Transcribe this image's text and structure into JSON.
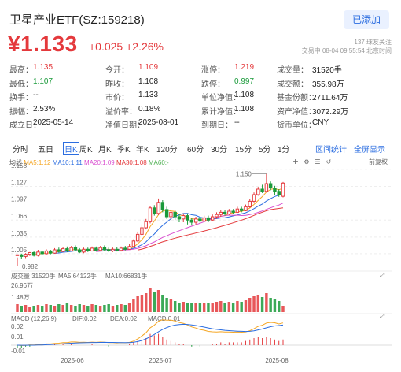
{
  "header": {
    "title": "卫星产业ETF(SZ:159218)",
    "add_label": "已添加",
    "price": "¥1.133",
    "change": "+0.025",
    "change_pct": "+2.26%",
    "follow_count": "137 球友关注",
    "trade_time": "交易中 08-04 09:55:54 北京时间"
  },
  "quote": [
    [
      {
        "k": "最高：",
        "v": "1.135",
        "c": "red"
      },
      {
        "k": "今开：",
        "v": "1.109",
        "c": "red"
      },
      {
        "k": "涨停：",
        "v": "1.219",
        "c": "red"
      },
      {
        "k": "成交量：",
        "v": "31520手",
        "c": ""
      }
    ],
    [
      {
        "k": "最低：",
        "v": "1.107",
        "c": "green"
      },
      {
        "k": "昨收：",
        "v": "1.108",
        "c": ""
      },
      {
        "k": "跌停：",
        "v": "0.997",
        "c": "green"
      },
      {
        "k": "成交额：",
        "v": "355.98万",
        "c": ""
      }
    ],
    [
      {
        "k": "换手：",
        "v": "--",
        "c": ""
      },
      {
        "k": "市价：",
        "v": "1.133",
        "c": ""
      },
      {
        "k": "单位净值：",
        "v": "1.108",
        "c": ""
      },
      {
        "k": "基金份额：",
        "v": "2711.64万",
        "c": ""
      }
    ],
    [
      {
        "k": "振幅：",
        "v": "2.53%",
        "c": ""
      },
      {
        "k": "溢价率：",
        "v": "0.18%",
        "c": ""
      },
      {
        "k": "累计净值：",
        "v": "1.108",
        "c": ""
      },
      {
        "k": "资产净值：",
        "v": "3072.29万",
        "c": ""
      }
    ],
    [
      {
        "k": "成立日：",
        "v": "2025-05-14",
        "c": ""
      },
      {
        "k": "净值日期：",
        "v": "2025-08-01",
        "c": ""
      },
      {
        "k": "到期日：",
        "v": "--",
        "c": ""
      },
      {
        "k": "货币单位：",
        "v": "CNY",
        "c": ""
      }
    ]
  ],
  "tabs": [
    "分时",
    "五日",
    "日K",
    "周K",
    "月K",
    "季K",
    "年K",
    "120分",
    "60分",
    "30分",
    "15分",
    "5分",
    "1分"
  ],
  "active_tab": "日K",
  "tab_links": {
    "interval": "区间统计",
    "fullscreen": "全屏显示"
  },
  "chart_controls": {
    "line_label": "均线",
    "restore_label": "前复权"
  },
  "ma_legend": [
    {
      "label": "MA5:1.12",
      "color": "#f5a623"
    },
    {
      "label": "MA10:1.11",
      "color": "#2b6de0"
    },
    {
      "label": "MA20:1.09",
      "color": "#d94fd0"
    },
    {
      "label": "MA30:1.08",
      "color": "#e4393c"
    },
    {
      "label": "MA60:-",
      "color": "#4caf50"
    }
  ],
  "volume_legend": [
    {
      "label": "成交量 31520手",
      "color": "#555"
    },
    {
      "label": "MA5:64122手",
      "color": "#f5a623"
    },
    {
      "label": "MA10:66831手",
      "color": "#2b6de0"
    }
  ],
  "macd_legend": [
    {
      "label": "MACD (12,26,9)",
      "color": "#555"
    },
    {
      "label": "DIF:0.02",
      "color": "#f5a623"
    },
    {
      "label": "DEA:0.02",
      "color": "#2b6de0"
    },
    {
      "label": "MACD:0.01",
      "color": "#e4393c"
    }
  ],
  "colors": {
    "up": "#e4393c",
    "down": "#1a9a3a",
    "accent": "#2b6de0"
  },
  "chart_data": [
    {
      "type": "candlestick",
      "title": "",
      "y_ticks": [
        "1.158",
        "1.127",
        "1.097",
        "1.066",
        "1.035",
        "1.005"
      ],
      "ylim": [
        0.982,
        1.162
      ],
      "x_ticks": [
        "2025-06",
        "2025-07",
        "2025-08"
      ],
      "annotations": [
        "1.150",
        "0.982"
      ],
      "candles": [
        [
          1.002,
          1.003,
          0.998,
          0.982
        ],
        [
          1.003,
          1.0,
          1.005,
          0.995
        ],
        [
          1.0,
          1.004,
          1.006,
          0.997
        ],
        [
          1.004,
          1.007,
          1.008,
          1.001
        ],
        [
          1.007,
          1.002,
          1.009,
          1.0
        ],
        [
          1.002,
          1.008,
          1.012,
          1.0
        ],
        [
          1.008,
          1.005,
          1.01,
          1.002
        ],
        [
          1.005,
          1.01,
          1.013,
          1.003
        ],
        [
          1.01,
          1.006,
          1.012,
          1.004
        ],
        [
          1.006,
          1.012,
          1.015,
          1.005
        ],
        [
          1.012,
          1.009,
          1.016,
          1.007
        ],
        [
          1.009,
          1.014,
          1.017,
          1.008
        ],
        [
          1.014,
          1.01,
          1.018,
          1.008
        ],
        [
          1.01,
          1.016,
          1.019,
          1.009
        ],
        [
          1.016,
          1.012,
          1.02,
          1.01
        ],
        [
          1.012,
          1.008,
          1.015,
          1.006
        ],
        [
          1.008,
          1.013,
          1.016,
          1.006
        ],
        [
          1.013,
          1.01,
          1.016,
          1.008
        ],
        [
          1.01,
          1.015,
          1.018,
          1.009
        ],
        [
          1.015,
          1.011,
          1.018,
          1.009
        ],
        [
          1.011,
          1.016,
          1.019,
          1.01
        ],
        [
          1.016,
          1.012,
          1.02,
          1.01
        ],
        [
          1.012,
          1.01,
          1.016,
          1.008
        ],
        [
          1.01,
          1.013,
          1.016,
          1.008
        ],
        [
          1.013,
          1.011,
          1.017,
          1.009
        ],
        [
          1.011,
          1.015,
          1.018,
          1.009
        ],
        [
          1.015,
          1.013,
          1.019,
          1.011
        ],
        [
          1.013,
          1.018,
          1.022,
          1.012
        ],
        [
          1.018,
          1.028,
          1.031,
          1.016
        ],
        [
          1.028,
          1.04,
          1.045,
          1.026
        ],
        [
          1.04,
          1.052,
          1.058,
          1.038
        ],
        [
          1.052,
          1.063,
          1.068,
          1.049
        ],
        [
          1.063,
          1.088,
          1.092,
          1.06
        ],
        [
          1.088,
          1.078,
          1.093,
          1.074
        ],
        [
          1.078,
          1.098,
          1.105,
          1.075
        ],
        [
          1.098,
          1.085,
          1.102,
          1.08
        ],
        [
          1.085,
          1.072,
          1.09,
          1.068
        ],
        [
          1.072,
          1.08,
          1.085,
          1.066
        ],
        [
          1.08,
          1.072,
          1.084,
          1.066
        ],
        [
          1.072,
          1.068,
          1.076,
          1.062
        ],
        [
          1.068,
          1.074,
          1.078,
          1.062
        ],
        [
          1.074,
          1.066,
          1.078,
          1.058
        ],
        [
          1.066,
          1.062,
          1.07,
          1.056
        ],
        [
          1.062,
          1.068,
          1.072,
          1.058
        ],
        [
          1.068,
          1.064,
          1.072,
          1.06
        ],
        [
          1.064,
          1.07,
          1.074,
          1.062
        ],
        [
          1.07,
          1.066,
          1.074,
          1.062
        ],
        [
          1.066,
          1.072,
          1.076,
          1.064
        ],
        [
          1.072,
          1.076,
          1.08,
          1.068
        ],
        [
          1.076,
          1.08,
          1.084,
          1.072
        ],
        [
          1.08,
          1.077,
          1.084,
          1.074
        ],
        [
          1.077,
          1.082,
          1.086,
          1.075
        ],
        [
          1.082,
          1.08,
          1.086,
          1.077
        ],
        [
          1.08,
          1.086,
          1.09,
          1.079
        ],
        [
          1.086,
          1.083,
          1.09,
          1.08
        ],
        [
          1.083,
          1.09,
          1.094,
          1.082
        ],
        [
          1.09,
          1.1,
          1.104,
          1.088
        ],
        [
          1.1,
          1.112,
          1.116,
          1.098
        ],
        [
          1.112,
          1.122,
          1.126,
          1.11
        ],
        [
          1.122,
          1.118,
          1.13,
          1.115
        ],
        [
          1.118,
          1.132,
          1.15,
          1.116
        ],
        [
          1.132,
          1.124,
          1.136,
          1.12
        ],
        [
          1.124,
          1.118,
          1.128,
          1.112
        ],
        [
          1.118,
          1.112,
          1.122,
          1.108
        ],
        [
          1.109,
          1.133,
          1.135,
          1.107
        ]
      ],
      "volume": [
        10,
        8,
        9,
        7,
        8,
        9,
        8,
        10,
        9,
        8,
        10,
        9,
        11,
        9,
        8,
        10,
        9,
        8,
        10,
        9,
        8,
        9,
        10,
        8,
        9,
        10,
        9,
        12,
        16,
        20,
        22,
        24,
        30,
        26,
        28,
        22,
        18,
        16,
        14,
        12,
        13,
        12,
        11,
        12,
        11,
        12,
        11,
        12,
        13,
        14,
        12,
        13,
        12,
        14,
        13,
        15,
        18,
        20,
        22,
        19,
        24,
        18,
        16,
        14,
        8
      ],
      "volume_max_label": "26.96万",
      "volume_mid_label": "1.48万",
      "macd_y_ticks": [
        "0.02",
        "0.01",
        "-0.01"
      ],
      "macd_bars": [
        -0.002,
        -0.002,
        -0.001,
        -0.001,
        0,
        0,
        0,
        0.001,
        0,
        0.001,
        0,
        0.001,
        0,
        0.001,
        0,
        0,
        0,
        0,
        0.001,
        0,
        0,
        0,
        -0.001,
        0,
        0,
        0,
        0,
        0.001,
        0.002,
        0.003,
        0.004,
        0.005,
        0.008,
        0.007,
        0.008,
        0.006,
        0.004,
        0.003,
        0.002,
        0.001,
        0.001,
        0,
        -0.001,
        0,
        -0.001,
        0,
        0,
        0.001,
        0.001,
        0.002,
        0.001,
        0.002,
        0.002,
        0.002,
        0.002,
        0.003,
        0.004,
        0.005,
        0.006,
        0.005,
        0.006,
        0.005,
        0.004,
        0.003,
        0.004
      ]
    }
  ]
}
